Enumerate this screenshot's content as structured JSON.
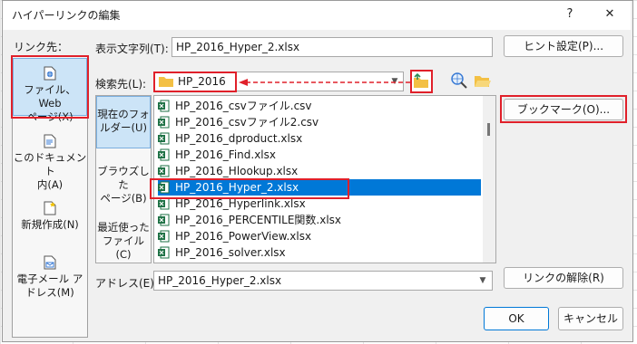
{
  "dialog": {
    "title": "ハイパーリンクの編集",
    "help_glyph": "?",
    "close_glyph": "✕"
  },
  "link_to": {
    "label": "リンク先：",
    "items": [
      {
        "label_l1": "ファイル、Web",
        "label_l2": "ページ(X)",
        "icon": "web-file-icon"
      },
      {
        "label_l1": "このドキュメント",
        "label_l2": "内(A)",
        "icon": "document-icon"
      },
      {
        "label_l1": "新規作成(N)",
        "label_l2": "",
        "icon": "new-document-icon"
      },
      {
        "label_l1": "電子メール ア",
        "label_l2": "ドレス(M)",
        "icon": "email-icon"
      }
    ]
  },
  "display_text": {
    "label": "表示文字列(T):",
    "value": "HP_2016_Hyper_2.xlsx"
  },
  "screen_tip_button": "ヒント設定(P)...",
  "look_in": {
    "label": "検索先(L):",
    "value": "HP_2016"
  },
  "bookmark_button": "ブックマーク(O)...",
  "left_nav": [
    {
      "l1": "現在のフォ",
      "l2": "ルダー(U)"
    },
    {
      "l1": "ブラウズした",
      "l2": "ページ(B)"
    },
    {
      "l1": "最近使った",
      "l2": "ファイル(C)"
    }
  ],
  "files": [
    "HP_2016_csvファイル.csv",
    "HP_2016_csvファイル2.csv",
    "HP_2016_dproduct.xlsx",
    "HP_2016_Find.xlsx",
    "HP_2016_Hlookup.xlsx",
    "HP_2016_Hyper_2.xlsx",
    "HP_2016_Hyperlink.xlsx",
    "HP_2016_PERCENTILE関数.xlsx",
    "HP_2016_PowerView.xlsx",
    "HP_2016_solver.xlsx"
  ],
  "address": {
    "label": "アドレス(E):",
    "value": "HP_2016_Hyper_2.xlsx"
  },
  "remove_link_button": "リンクの解除(R)",
  "ok_button": "OK",
  "cancel_button": "キャンセル",
  "colors": {
    "highlight_red": "#e0202a",
    "selection_blue": "#0078d7",
    "excel_green": "#1e7145"
  }
}
